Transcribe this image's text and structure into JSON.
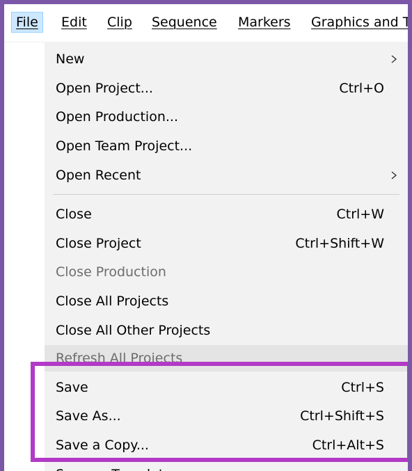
{
  "menubar": {
    "items": [
      {
        "label": "File",
        "active": true
      },
      {
        "label": "Edit"
      },
      {
        "label": "Clip"
      },
      {
        "label": "Sequence"
      },
      {
        "label": "Markers"
      },
      {
        "label": "Graphics and T"
      }
    ]
  },
  "file_menu": {
    "new": {
      "label": "New",
      "submenu_icon": "chevron-right-icon"
    },
    "open_project": {
      "label": "Open Project...",
      "shortcut": "Ctrl+O"
    },
    "open_production": {
      "label": "Open Production..."
    },
    "open_team_project": {
      "label": "Open Team Project..."
    },
    "open_recent": {
      "label": "Open Recent",
      "submenu_icon": "chevron-right-icon"
    },
    "close": {
      "label": "Close",
      "shortcut": "Ctrl+W"
    },
    "close_project": {
      "label": "Close Project",
      "shortcut": "Ctrl+Shift+W"
    },
    "close_production": {
      "label": "Close Production",
      "disabled": true
    },
    "close_all_projects": {
      "label": "Close All Projects"
    },
    "close_all_other_projects": {
      "label": "Close All Other Projects"
    },
    "refresh_all_projects": {
      "label": "Refresh All Projects",
      "disabled": true
    },
    "save": {
      "label": "Save",
      "shortcut": "Ctrl+S"
    },
    "save_as": {
      "label": "Save As...",
      "shortcut": "Ctrl+Shift+S"
    },
    "save_a_copy": {
      "label": "Save a Copy...",
      "shortcut": "Ctrl+Alt+S"
    },
    "save_as_template": {
      "label": "Save as Template..."
    }
  },
  "colors": {
    "frame_border": "#7c57a8",
    "highlight_box": "#b23ac6",
    "menu_background": "#f2f2f2",
    "active_menu_background": "#cce8ff"
  }
}
